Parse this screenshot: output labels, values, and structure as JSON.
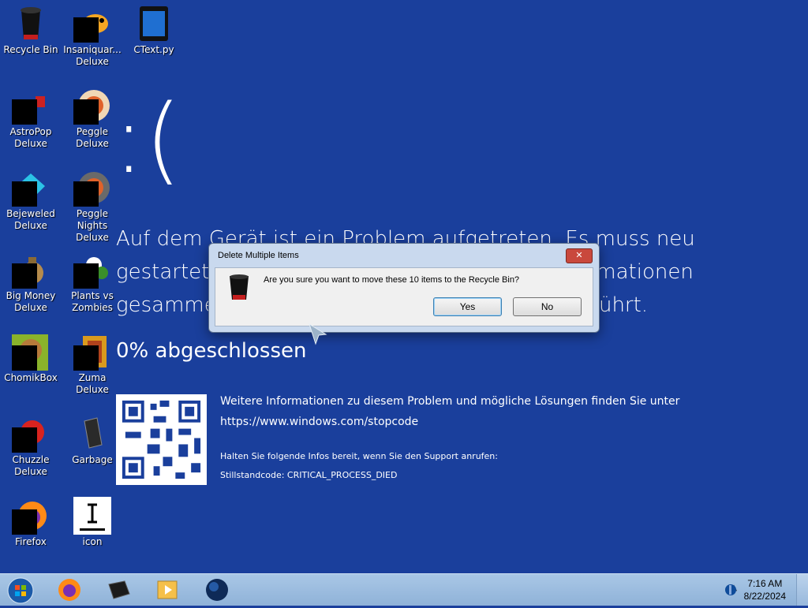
{
  "desktop": {
    "icons": [
      {
        "label": "Recycle Bin",
        "icon": "recycle-bin-icon"
      },
      {
        "label": "Insaniquar... Deluxe",
        "icon": "fish-icon"
      },
      {
        "label": "CText.py",
        "icon": "file-icon"
      },
      {
        "label": "AstroPop Deluxe",
        "icon": "astropop-icon"
      },
      {
        "label": "Peggle Deluxe",
        "icon": "peggle-icon"
      },
      {
        "label": "Bejeweled Deluxe",
        "icon": "bejeweled-icon"
      },
      {
        "label": "Peggle Nights Deluxe",
        "icon": "peggle-nights-icon"
      },
      {
        "label": "Big Money Deluxe",
        "icon": "money-bag-icon"
      },
      {
        "label": "Plants vs Zombies",
        "icon": "plant-icon"
      },
      {
        "label": "ChomikBox",
        "icon": "hamster-icon"
      },
      {
        "label": "Zuma Deluxe",
        "icon": "zuma-icon"
      },
      {
        "label": "Chuzzle Deluxe",
        "icon": "chuzzle-icon"
      },
      {
        "label": "Garbage",
        "icon": "garbage-icon"
      },
      {
        "label": "Firefox",
        "icon": "firefox-icon"
      },
      {
        "label": "icon",
        "icon": "text-cursor-icon"
      }
    ]
  },
  "bsod": {
    "face": ":(",
    "message": "Auf dem Gerät ist ein Problem aufgetreten. Es muss neu gestartet werden. Es werden einige Fehlerinformationen gesammelt, und dann wird ein Neustart ausgeführt.",
    "progress": "0% abgeschlossen",
    "info_line1": "Weitere Informationen zu diesem Problem und mögliche Lösungen finden Sie unter",
    "info_url": "https://www.windows.com/stopcode",
    "support_line": "Halten Sie folgende Infos bereit, wenn Sie den Support anrufen:",
    "stopcode": "Stillstandcode: CRITICAL_PROCESS_DIED"
  },
  "dialog": {
    "title": "Delete Multiple Items",
    "close": "✕",
    "message": "Are you sure you want to move these 10 items to the Recycle Bin?",
    "yes_label": "Yes",
    "no_label": "No"
  },
  "taskbar": {
    "items": [
      "start-orb-icon",
      "firefox-icon",
      "garbage-icon",
      "media-player-icon",
      "globe-icon"
    ],
    "time": "7:16 AM",
    "date": "8/22/2024",
    "tray_arrow": "▲"
  }
}
